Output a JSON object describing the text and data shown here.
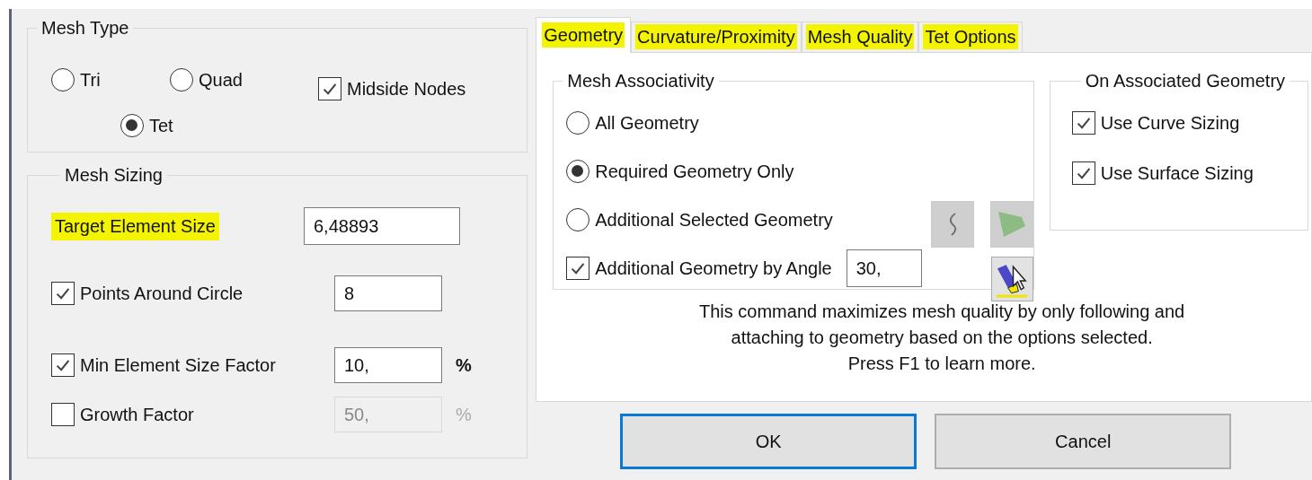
{
  "mesh_type": {
    "title": "Mesh Type",
    "options": [
      {
        "label": "Tri",
        "selected": false
      },
      {
        "label": "Quad",
        "selected": false
      },
      {
        "label": "Tet",
        "selected": true
      }
    ],
    "midside_nodes": {
      "label": "Midside Nodes",
      "checked": true
    }
  },
  "mesh_sizing": {
    "title": "Mesh Sizing",
    "target_size": {
      "label": "Target Element Size",
      "value": "6,48893",
      "highlighted": true
    },
    "rows": [
      {
        "label": "Points Around Circle",
        "checked": true,
        "value": "8",
        "disabled": false
      },
      {
        "label": "Min Element Size Factor",
        "checked": true,
        "value": "10,",
        "unit": "%",
        "disabled": false
      },
      {
        "label": "Growth Factor",
        "checked": false,
        "value": "50,",
        "unit": "%",
        "disabled": true
      }
    ]
  },
  "tabs": [
    {
      "label": "Geometry",
      "selected": true,
      "highlighted": true
    },
    {
      "label": "Curvature/Proximity",
      "selected": false,
      "highlighted": true
    },
    {
      "label": "Mesh Quality",
      "selected": false,
      "highlighted": true
    },
    {
      "label": "Tet Options",
      "selected": false,
      "highlighted": true
    }
  ],
  "mesh_associativity": {
    "title": "Mesh Associativity",
    "options": [
      {
        "label": "All Geometry",
        "selected": false
      },
      {
        "label": "Required Geometry Only",
        "selected": true
      },
      {
        "label": "Additional Selected Geometry",
        "selected": false
      }
    ],
    "by_angle": {
      "label": "Additional Geometry by Angle",
      "checked": true,
      "value": "30,"
    }
  },
  "associated": {
    "title": "On Associated Geometry",
    "items": [
      {
        "label": "Use Curve Sizing",
        "checked": true
      },
      {
        "label": "Use Surface Sizing",
        "checked": true
      }
    ]
  },
  "description": [
    "This command maximizes mesh quality by only following and",
    "attaching to geometry based on the options selected.",
    "Press F1 to learn more."
  ],
  "buttons": [
    {
      "label": "OK",
      "default": true
    },
    {
      "label": "Cancel",
      "default": false
    }
  ]
}
